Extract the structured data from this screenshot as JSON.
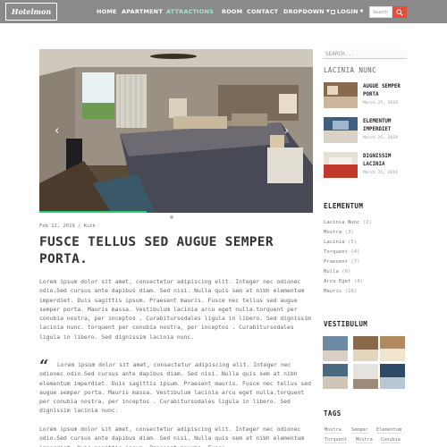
{
  "nav": {
    "logo": "Hotelmon",
    "items": [
      {
        "label": "HOME"
      },
      {
        "label": "APARTMENT"
      },
      {
        "label": "ATTRACTIONS"
      },
      {
        "label": "ROOM"
      },
      {
        "label": "CONTACT"
      },
      {
        "label": "DROPDOWN"
      },
      {
        "label": "LOGIN"
      }
    ],
    "active_index": 2,
    "search_placeholder": "Search",
    "colors": {
      "bar": "#8a8a8a",
      "active": "#a8e6c9",
      "search_button": "#e74c3c"
    }
  },
  "slider": {
    "prev_icon": "chevron-left-icon",
    "next_icon": "chevron-right-icon",
    "dots": 2,
    "active_dot": 1
  },
  "post": {
    "meta": "Feb 12, 2019 / Kuzk",
    "title": "FUSCE TELLUS SED AUGUE SEMPER PORTA.",
    "paragraph1": "Lorem ipsum dolor sit amet, consectetur adipiscing elit. Integer nec odionec odio.Sed cursus ante dapibus diam. Sed nisi. Nulla quis sem at nibh elementum imperdiet. Duis sagittis ipsum. Praesent mauris. Fusce nec tellus sed augue semper porta. Mauris massa. Vestibulum lacinia arcu eget nulla.torquent per conubia nostra, per inceptos . Curabitursodales ligula in libero. Sed dignissim lacinia nunc. torquent per conubia nostra, per inceptos . Curabitursodales ligula in libero. Sed dignissim lacinia nunc.",
    "quote": "Lorem ipsum dolor sit amet, consectetur adipiscing elit. Integer nec odionec odio.Sed cursus ante dapibus diam. Sed nisi. Nulla quis sem at nibh elementum imperdiet. Duis sagittis ipsum. Praesent mauris. Fusce nec tellus sed augue semper porta. Mauris massa. Vestibulum lacinia arcu eget nulla.torquent per conubia nostra, per inceptos . Curabitursodales ligula in libero. Sed dignissim lacinia nunc.",
    "paragraph3": "Lorem ipsum dolor sit amet, consectetur adipiscing elit. Integer nec odionec odio.Sed cursus ante dapibus diam. Sed nisi. Nulla quis sem at nibh elementum imperdiet. Duis sagittis ipsum. Praesent mauris. Fusce"
  },
  "sidebar": {
    "search_placeholder": "SEARCH...",
    "recent_title": "LACINIA NUNC",
    "recent": [
      {
        "title": "AUGUE SEMPER PORTA",
        "date": "March 25, 2019"
      },
      {
        "title": "ELEMENTUM IMPERDIET",
        "date": "March 25, 2019"
      },
      {
        "title": "DIGNISSIM LACINIA",
        "date": "March 25, 2019"
      }
    ],
    "categories_title": "ELEMENTUM",
    "categories": [
      {
        "name": "Lacinia Nunc",
        "count": "(2)"
      },
      {
        "name": "Mostra",
        "count": "(3)"
      },
      {
        "name": "Lacinia",
        "count": "(5)"
      },
      {
        "name": "Torquent",
        "count": "(4)"
      },
      {
        "name": "Praesent",
        "count": "(7)"
      },
      {
        "name": "Nulla",
        "count": "(6)"
      },
      {
        "name": "Arcu Eget",
        "count": "(4)"
      },
      {
        "name": "Mauris",
        "count": "(10)"
      }
    ],
    "gallery_title": "VESTIBULUM",
    "tags_title": "TAGS",
    "tags": [
      "Mostra",
      "Semper",
      "Elementum",
      "Torquent",
      "Mostra",
      "Conubia"
    ]
  }
}
